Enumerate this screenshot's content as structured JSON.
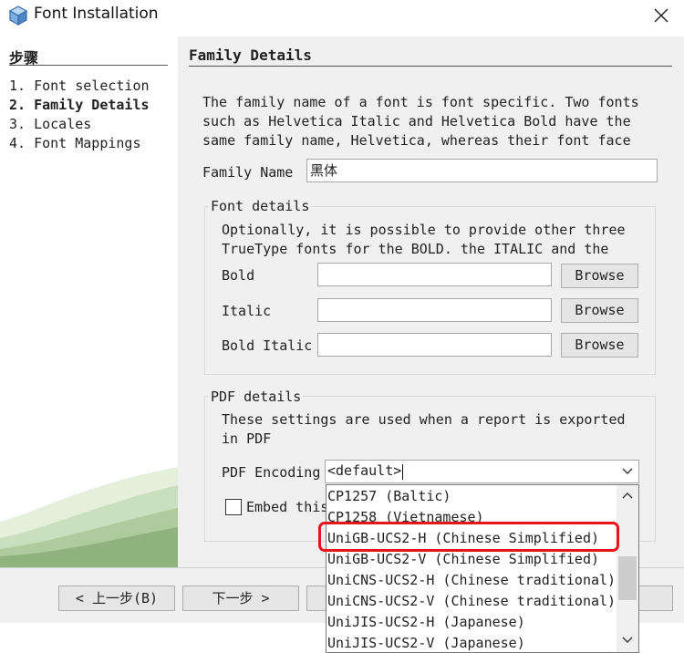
{
  "window": {
    "title": "Font Installation",
    "app_icon": "cube-icon",
    "close_icon": "close-icon"
  },
  "steps": {
    "heading": "步骤",
    "items": [
      {
        "label": "1. Font selection",
        "active": false
      },
      {
        "label": "2. Family Details",
        "active": true
      },
      {
        "label": "3. Locales",
        "active": false
      },
      {
        "label": "4. Font Mappings",
        "active": false
      }
    ]
  },
  "panel": {
    "heading": "Family Details",
    "description": "The family name of a font is font specific. Two fonts\nsuch as Helvetica Italic and Helvetica Bold have the\nsame family name, Helvetica, whereas their font face",
    "family_name_label": "Family Name",
    "family_name_value": "黑体",
    "font_details": {
      "title": "Font details",
      "description": "Optionally, it is possible to provide other three\nTrueType fonts for the BOLD. the ITALIC and the",
      "bold_label": "Bold",
      "italic_label": "Italic",
      "bold_italic_label": "Bold Italic",
      "bold_value": "",
      "italic_value": "",
      "bold_italic_value": "",
      "browse_label": "Browse"
    },
    "pdf_details": {
      "title": "PDF details",
      "description": "These settings are used when a report is exported\nin PDF",
      "encoding_label": "PDF Encoding",
      "encoding_value": "<default>",
      "embed_label": "Embed this",
      "embed_checked": false
    }
  },
  "dropdown": {
    "options": [
      "CP1257 (Baltic)",
      "CP1258 (Vietnamese)",
      "UniGB-UCS2-H (Chinese Simplified)",
      "UniGB-UCS2-V (Chinese Simplified)",
      "UniCNS-UCS2-H (Chinese traditional)",
      "UniCNS-UCS2-V (Chinese traditional)",
      "UniJIS-UCS2-H (Japanese)",
      "UniJIS-UCS2-V (Japanese)"
    ],
    "highlighted_option": "UniGB-UCS2-H (Chinese Simplified)",
    "highlight_color": "#e8141b"
  },
  "buttons": {
    "back": "< 上一步(B)",
    "next": "下一步 >"
  }
}
